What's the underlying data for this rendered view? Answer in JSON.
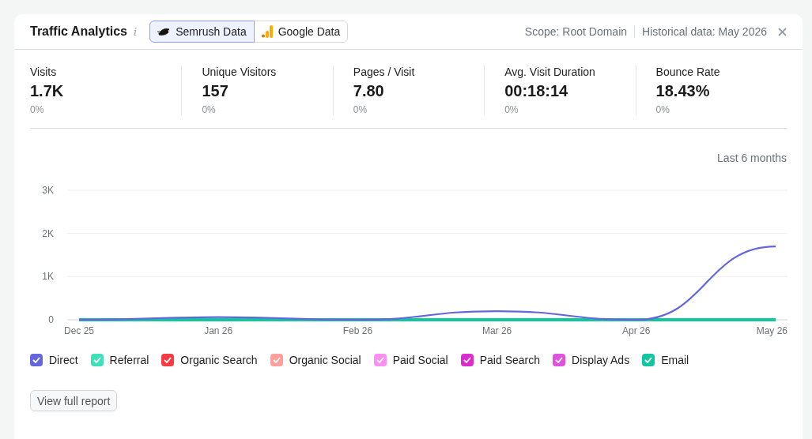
{
  "header": {
    "title": "Traffic Analytics",
    "info_icon": "i",
    "sources": [
      {
        "label": "Semrush Data",
        "selected": true
      },
      {
        "label": "Google Data",
        "selected": false
      }
    ],
    "scope": "Scope: Root Domain",
    "historical": "Historical data: May 2026"
  },
  "metrics": [
    {
      "label": "Visits",
      "value": "1.7K",
      "change": "0%"
    },
    {
      "label": "Unique Visitors",
      "value": "157",
      "change": "0%"
    },
    {
      "label": "Pages / Visit",
      "value": "7.80",
      "change": "0%"
    },
    {
      "label": "Avg. Visit Duration",
      "value": "00:18:14",
      "change": "0%"
    },
    {
      "label": "Bounce Rate",
      "value": "18.43%",
      "change": "0%"
    }
  ],
  "period": "Last 6 months",
  "chart_data": {
    "type": "line",
    "categories": [
      "Dec 25",
      "Jan 26",
      "Feb 26",
      "Mar 26",
      "Apr 26",
      "May 26"
    ],
    "ylim": [
      0,
      3000
    ],
    "yticks": [
      {
        "value": 0,
        "label": "0"
      },
      {
        "value": 1000,
        "label": "1K"
      },
      {
        "value": 2000,
        "label": "2K"
      },
      {
        "value": 3000,
        "label": "3K"
      }
    ],
    "series": [
      {
        "name": "Direct",
        "color": "#6466dc",
        "values": [
          0,
          60,
          0,
          200,
          0,
          1700
        ]
      },
      {
        "name": "Email",
        "color": "#12c79d",
        "values": [
          0,
          0,
          0,
          0,
          0,
          0
        ]
      }
    ]
  },
  "legend": [
    {
      "kind": "series",
      "checked": true
    },
    {
      "label": "Referral",
      "checked": true,
      "color": "#3ee0b8"
    },
    {
      "label": "Organic Search",
      "checked": true,
      "color": "#f53a43"
    },
    {
      "label": "Organic Social",
      "checked": true,
      "color": "#ff9e9a"
    },
    {
      "label": "Paid Social",
      "checked": true,
      "color": "#ff8ef2"
    },
    {
      "label": "Paid Search",
      "checked": true,
      "color": "#de2bd0"
    },
    {
      "label": "Display Ads",
      "checked": true,
      "color": "#e051e0"
    },
    {
      "kind": "series",
      "checked": true
    }
  ],
  "footer_button": "View full report"
}
